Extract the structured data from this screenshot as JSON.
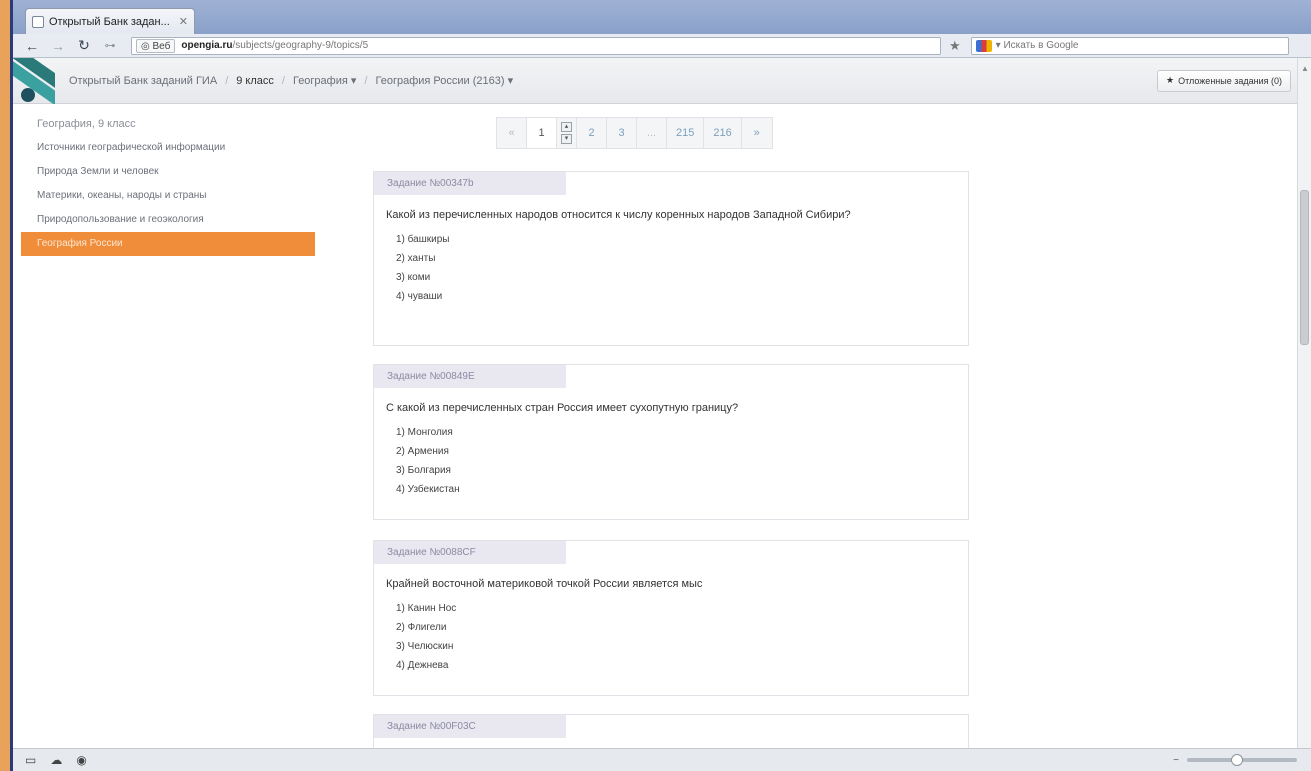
{
  "browser": {
    "tab_title": "Открытый Банк задан...",
    "url_badge": "Веб",
    "url_host": "opengia.ru",
    "url_path": "/subjects/geography-9/topics/5",
    "search_placeholder": "Искать в Google"
  },
  "header": {
    "breadcrumb": {
      "home": "Открытый Банк заданий ГИА",
      "grade": "9 класс",
      "subject": "География",
      "topic": "География России (2163)"
    },
    "saved_button": "Отложенные задания (0)"
  },
  "sidebar": {
    "heading": "География, 9 класс",
    "items": [
      {
        "label": "Источники географической информации"
      },
      {
        "label": "Природа Земли и человек"
      },
      {
        "label": "Материки, океаны, народы и страны"
      },
      {
        "label": "Природопользование и геоэкология"
      },
      {
        "label": "География России"
      }
    ]
  },
  "pagination": {
    "prev": "«",
    "pages": [
      "1",
      "2",
      "3",
      "...",
      "215",
      "216"
    ],
    "next": "»"
  },
  "tasks": [
    {
      "id": "Задание №00347b",
      "question": "Какой из перечисленных народов относится к числу коренных народов Западной Сибири?",
      "options": [
        "1) башкиры",
        "2) ханты",
        "3) коми",
        "4) чуваши"
      ]
    },
    {
      "id": "Задание №00849E",
      "question": "С какой из перечисленных стран Россия имеет сухопутную границу?",
      "options": [
        "1) Монголия",
        "2) Армения",
        "3) Болгария",
        "4) Узбекистан"
      ]
    },
    {
      "id": "Задание №0088CF",
      "question": "Крайней восточной материковой точкой России является мыс",
      "options": [
        "1) Канин Нос",
        "2) Флигели",
        "3) Челюскин",
        "4) Дежнева"
      ]
    },
    {
      "id": "Задание №00F03C"
    }
  ]
}
